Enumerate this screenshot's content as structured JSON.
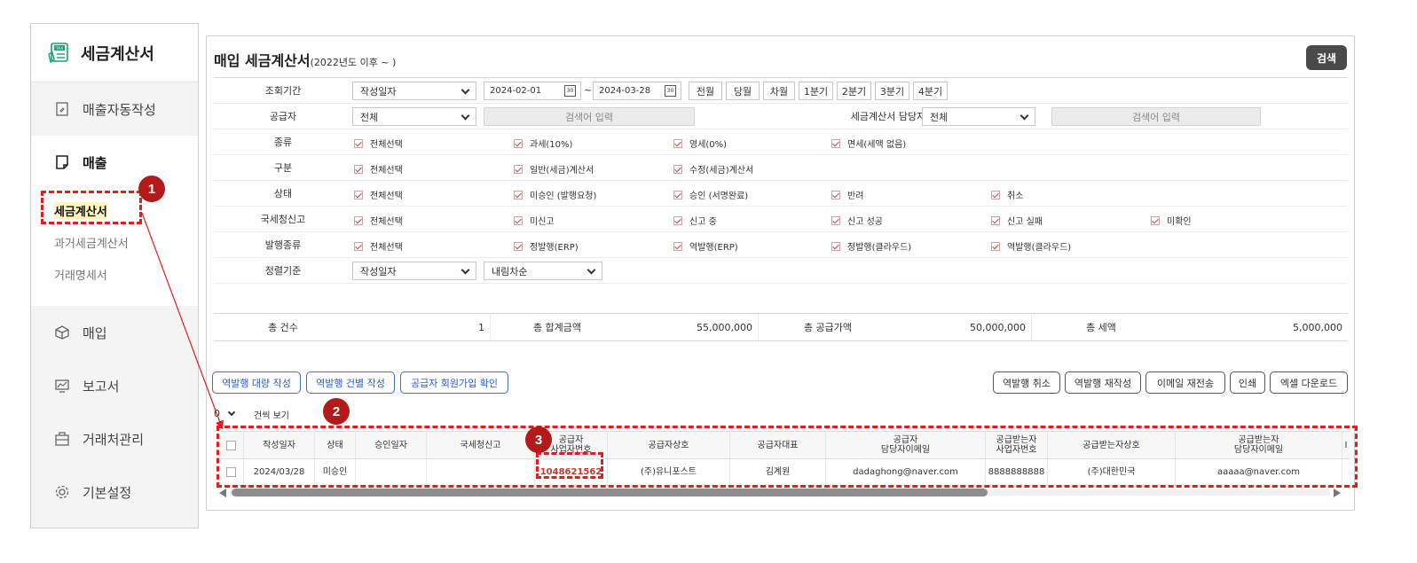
{
  "sidebar": {
    "brand_title": "세금계산서",
    "brand_icon_text": "TAX",
    "items": [
      {
        "label": "매출자동작성"
      },
      {
        "label": "매출"
      },
      {
        "label": "매입"
      },
      {
        "label": "보고서"
      },
      {
        "label": "거래처관리"
      },
      {
        "label": "기본설정"
      }
    ],
    "sub_items": [
      {
        "label": "세금계산서"
      },
      {
        "label": "과거세금계산서"
      },
      {
        "label": "거래명세서"
      }
    ]
  },
  "page": {
    "title": "매입 세금계산서",
    "title_suffix": "(2022년도 이후 ~ )",
    "search_button": "검색"
  },
  "filters": {
    "period": {
      "label": "조회기간",
      "type_value": "작성일자",
      "date_from": "2024-02-01",
      "date_to": "2024-03-28",
      "calendar_icon_text": "30",
      "tilde": "~",
      "quick_buttons": [
        "전월",
        "당월",
        "차월",
        "1분기",
        "2분기",
        "3분기",
        "4분기"
      ]
    },
    "supplier": {
      "label": "공급자",
      "select_value": "전체",
      "input_placeholder": "검색어 입력",
      "manager_label": "세금계산서 담당자",
      "manager_select_value": "전체",
      "manager_input_placeholder": "검색어 입력"
    },
    "kind": {
      "label": "종류",
      "options": [
        "전체선택",
        "과세(10%)",
        "영세(0%)",
        "면세(세액 없음)"
      ]
    },
    "category": {
      "label": "구분",
      "options": [
        "전체선택",
        "일반(세금)계산서",
        "수정(세금)계산서"
      ]
    },
    "status": {
      "label": "상태",
      "options": [
        "전체선택",
        "미승인 (발행요청)",
        "승인 (서명완료)",
        "반려",
        "취소"
      ]
    },
    "nts_report": {
      "label": "국세청신고",
      "options": [
        "전체선택",
        "미신고",
        "신고 중",
        "신고 성공",
        "신고 실패",
        "미확인"
      ]
    },
    "issue_type": {
      "label": "발행종류",
      "options": [
        "전체선택",
        "정발행(ERP)",
        "역발행(ERP)",
        "정발행(클라우드)",
        "역발행(클라우드)"
      ]
    },
    "sort": {
      "label": "정렬기준",
      "field_value": "작성일자",
      "order_value": "내림차순"
    }
  },
  "totals": {
    "count_label": "총 건수",
    "count_value": "1",
    "sum_label": "총 합계금액",
    "sum_value": "55,000,000",
    "supply_label": "총 공급가액",
    "supply_value": "50,000,000",
    "tax_label": "총 세액",
    "tax_value": "5,000,000"
  },
  "actions": {
    "left": [
      "역발행 대량 작성",
      "역발행 건별 작성",
      "공급자 회원가입 확인"
    ],
    "right": [
      "역발행 취소",
      "역발행 재작성",
      "이메일 재전송",
      "인쇄",
      "엑셀 다운로드"
    ]
  },
  "page_size": {
    "value": "0",
    "label": "건씩 보기"
  },
  "table": {
    "headers": [
      "작성일자",
      "상태",
      "승인일자",
      "국세청신고",
      "공급자\n사업자번호",
      "공급자상호",
      "공급자대표",
      "공급자\n담당자이메일",
      "공급받는자\n사업자번호",
      "공급받는자상호",
      "공급받는자\n담당자이메일",
      "I"
    ],
    "rows": [
      [
        "2024/03/28",
        "미승인",
        "",
        "",
        "1048621562",
        "(주)유니포스트",
        "김계원",
        "dadaghong@naver.com",
        "8888888888",
        "(주)대한민국",
        "aaaaa@naver.com",
        ""
      ]
    ]
  },
  "annotations": {
    "badges": [
      "1",
      "2",
      "3"
    ]
  },
  "colors": {
    "annotation_red": "#e11d1d",
    "badge_red": "#b31b1b",
    "link_red": "#c0392b",
    "action_blue": "#2a5cc8"
  }
}
